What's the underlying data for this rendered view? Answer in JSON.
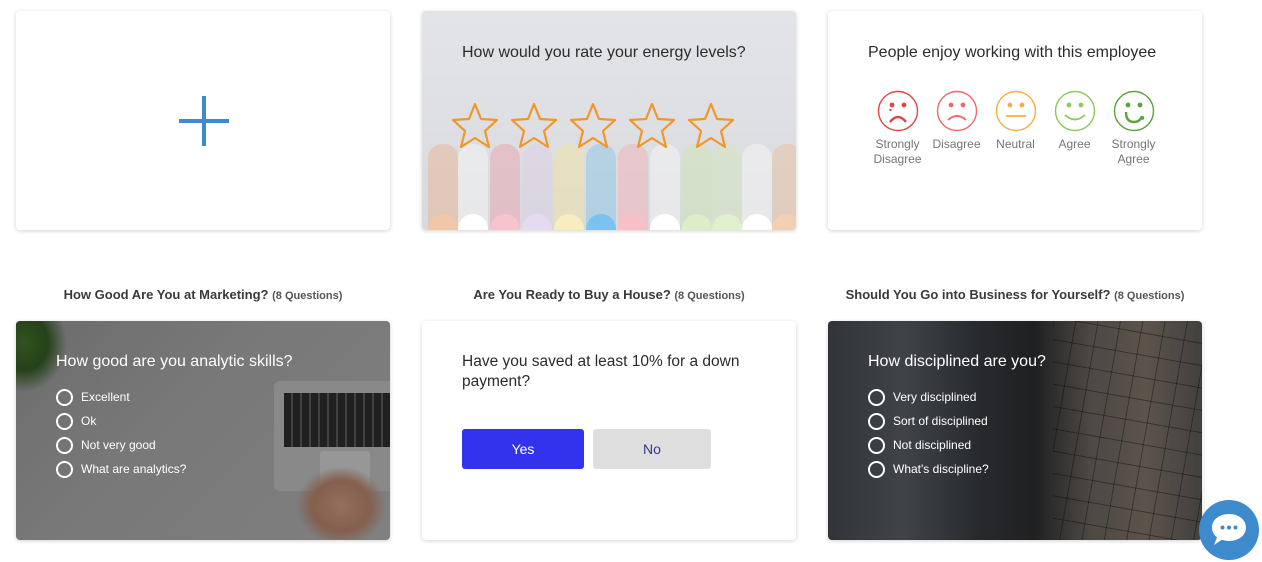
{
  "add_card": {
    "icon": "plus-icon"
  },
  "rating_card": {
    "question": "How would you rate your energy levels?",
    "star_count": 5,
    "star_color": "#f0962a"
  },
  "smiley_card": {
    "question": "People enjoy working with this employee",
    "options": [
      {
        "label": "Strongly Disagree",
        "line1": "Strongly",
        "line2": "Disagree",
        "color": "#e04545"
      },
      {
        "label": "Disagree",
        "line1": "Disagree",
        "line2": "",
        "color": "#ee6a6a"
      },
      {
        "label": "Neutral",
        "line1": "Neutral",
        "line2": "",
        "color": "#f5b040"
      },
      {
        "label": "Agree",
        "line1": "Agree",
        "line2": "",
        "color": "#8cc85a"
      },
      {
        "label": "Strongly Agree",
        "line1": "Strongly",
        "line2": "Agree",
        "color": "#5aa23a"
      }
    ]
  },
  "quizzes": [
    {
      "title": "How Good Are You at Marketing?",
      "count": "(8 Questions)",
      "question": "How good are you analytic skills?",
      "options": [
        "Excellent",
        "Ok",
        "Not very good",
        "What are analytics?"
      ]
    },
    {
      "title": "Are You Ready to Buy a House?",
      "count": "(8 Questions)",
      "question": "Have you saved at least 10% for a down payment?",
      "yes_label": "Yes",
      "no_label": "No"
    },
    {
      "title": "Should You Go into Business for Yourself?",
      "count": "(8 Questions)",
      "question": "How disciplined are you?",
      "options": [
        "Very disciplined",
        "Sort of disciplined",
        "Not disciplined",
        "What's discipline?"
      ]
    }
  ],
  "colors": {
    "accent_blue": "#3d8bcd",
    "yes_button": "#3333ee",
    "no_button": "#dedede"
  },
  "chat": {
    "icon": "chat-bubble-icon"
  }
}
